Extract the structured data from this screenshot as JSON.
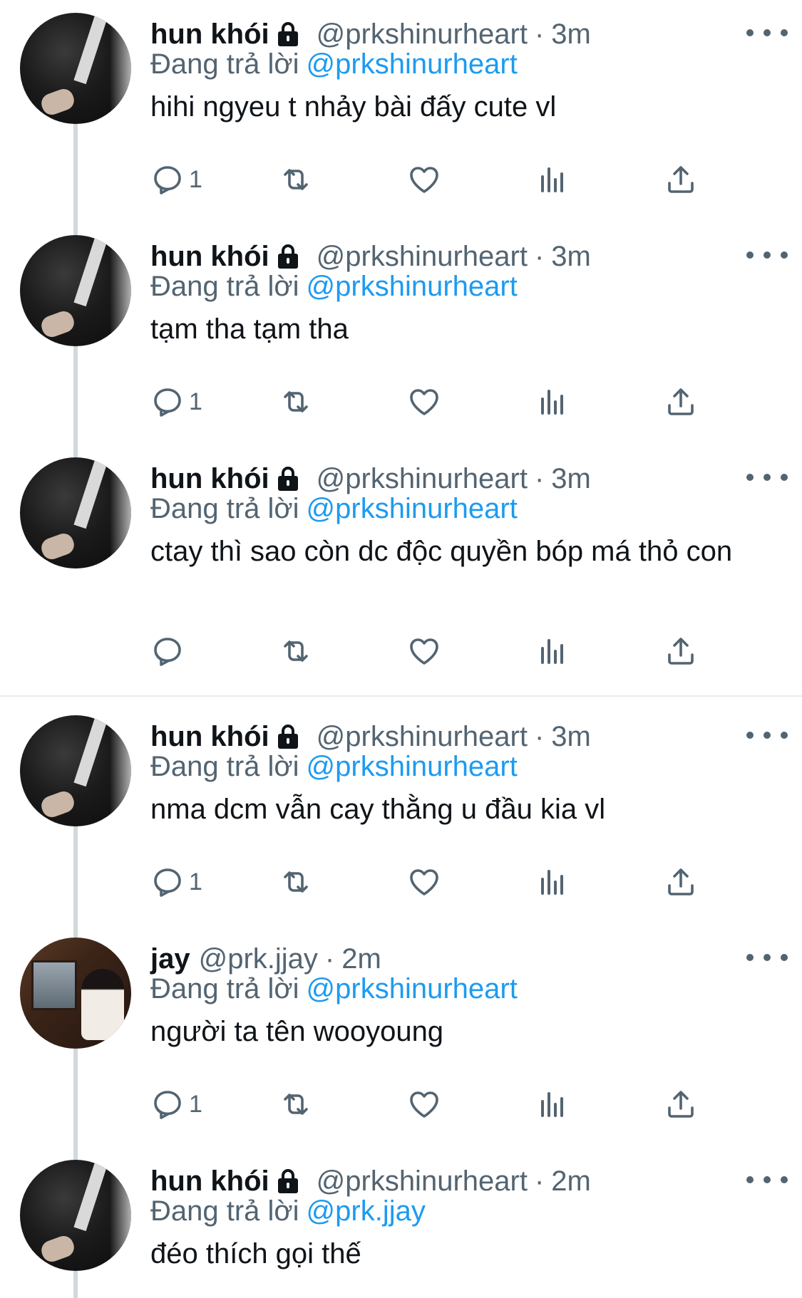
{
  "colors": {
    "link": "#1d9bf0",
    "secondary": "#536471",
    "text": "#0f1419",
    "thread": "#cfd9de"
  },
  "tweets": [
    {
      "name": "hun khói",
      "locked": true,
      "handle": "@prkshinurheart",
      "sep": "·",
      "time": "3m",
      "reply_prefix": "Đang trả lời",
      "reply_to": "@prkshinurheart",
      "text": "hihi ngyeu t nhảy bài đấy cute vl",
      "reply_count": "1"
    },
    {
      "name": "hun khói",
      "locked": true,
      "handle": "@prkshinurheart",
      "sep": "·",
      "time": "3m",
      "reply_prefix": "Đang trả lời",
      "reply_to": "@prkshinurheart",
      "text": "tạm tha tạm tha",
      "reply_count": "1"
    },
    {
      "name": "hun khói",
      "locked": true,
      "handle": "@prkshinurheart",
      "sep": "·",
      "time": "3m",
      "reply_prefix": "Đang trả lời",
      "reply_to": "@prkshinurheart",
      "text": "ctay thì sao còn dc độc quyền bóp má thỏ con",
      "reply_count": ""
    },
    {
      "name": "hun khói",
      "locked": true,
      "handle": "@prkshinurheart",
      "sep": "·",
      "time": "3m",
      "reply_prefix": "Đang trả lời",
      "reply_to": "@prkshinurheart",
      "text": "nma dcm vẫn cay thằng u đầu kia vl",
      "reply_count": "1"
    },
    {
      "name": "jay",
      "locked": false,
      "handle": "@prk.jjay",
      "sep": "·",
      "time": "2m",
      "reply_prefix": "Đang trả lời",
      "reply_to": "@prkshinurheart",
      "text": "người ta tên wooyoung",
      "reply_count": "1"
    },
    {
      "name": "hun khói",
      "locked": true,
      "handle": "@prkshinurheart",
      "sep": "·",
      "time": "2m",
      "reply_prefix": "Đang trả lời",
      "reply_to": "@prk.jjay",
      "text": "đéo thích gọi thế",
      "reply_count": ""
    }
  ],
  "icons": {
    "reply": "reply-icon",
    "retweet": "retweet-icon",
    "like": "heart-icon",
    "views": "views-chart-icon",
    "share": "share-icon",
    "more": "more-dots-icon",
    "lock": "lock-icon"
  }
}
